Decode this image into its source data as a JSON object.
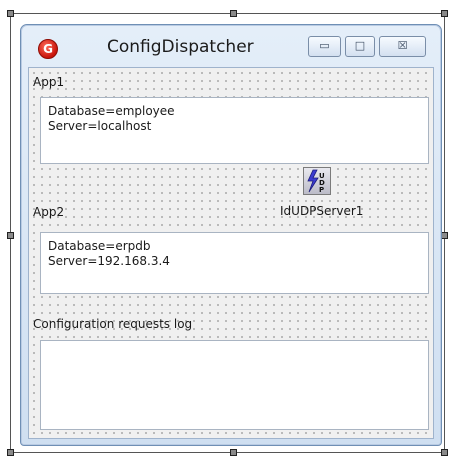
{
  "window": {
    "title": "ConfigDispatcher",
    "app_icon_glyph": "G",
    "icons": {
      "app": "delphi-app-icon",
      "minimize": "minimize-icon",
      "maximize": "maximize-icon",
      "close": "close-icon",
      "udp_component": "udp-server-component-icon"
    },
    "buttons": {
      "minimize_glyph": "▭",
      "maximize_glyph": "□",
      "close_glyph": "☒"
    }
  },
  "app1": {
    "label": "App1",
    "lines": [
      "Database=employee",
      "Server=localhost"
    ]
  },
  "app2": {
    "label": "App2",
    "lines": [
      "Database=erpdb",
      "Server=192.168.3.4"
    ]
  },
  "component": {
    "name": "IdUDPServer1"
  },
  "log": {
    "label": "Configuration requests log",
    "lines": []
  },
  "colors": {
    "accent": "#6f8fb5",
    "udp_icon_bolt": "#3b3bd0"
  }
}
